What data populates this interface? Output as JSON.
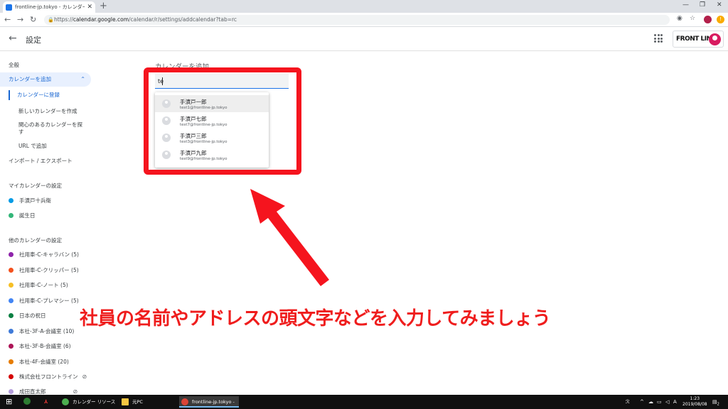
{
  "browser": {
    "tab_title": "frontline-jp.tokyo - カレンダー - 設定",
    "url_prefix": "https://",
    "url_host": "calendar.google.com",
    "url_path": "/calendar/r/settings/addcalendar?tab=rc"
  },
  "header": {
    "title": "設定",
    "logo_text": "FRONT LINE"
  },
  "sidebar": {
    "general": "全般",
    "add_calendar": "カレンダーを追加",
    "add_sub": [
      "カレンダーに登録",
      "新しいカレンダーを作成",
      "関心のあるカレンダーを探",
      "す",
      "URL で追加"
    ],
    "import_export": "インポート / エクスポート",
    "my_calendars_title": "マイカレンダーの設定",
    "my_calendars": [
      {
        "label": "手漬戸十兵衛",
        "color": "#039be5"
      },
      {
        "label": "誕生日",
        "color": "#33b679"
      }
    ],
    "other_calendars_title": "他のカレンダーの設定",
    "other_calendars": [
      {
        "label": "社用車-C-キャラバン (5)",
        "color": "#8e24aa"
      },
      {
        "label": "社用車-C-クリッパー (5)",
        "color": "#f4511e"
      },
      {
        "label": "社用車-C-ノート (5)",
        "color": "#f6bf26"
      },
      {
        "label": "社用車-C-プレマシー (5)",
        "color": "#4285f4"
      },
      {
        "label": "日本の祝日",
        "color": "#0b8043"
      },
      {
        "label": "本社-3F-A-会議室 (10)",
        "color": "#3f7ad8"
      },
      {
        "label": "本社-3F-B-会議室 (6)",
        "color": "#ad1457"
      },
      {
        "label": "本社-4F-会議室 (20)",
        "color": "#e67c00"
      },
      {
        "label": "株式会社フロントライン",
        "color": "#d50000"
      },
      {
        "label": "成田直太郎",
        "color": "#b39ddb"
      }
    ]
  },
  "main": {
    "section_title": "カレンダーを追加",
    "search_value": "te",
    "suggestions": [
      {
        "name": "手漬戸一郎",
        "email": "test1@frontline-jp.tokyo"
      },
      {
        "name": "手漬戸七郎",
        "email": "test7@frontline-jp.tokyo"
      },
      {
        "name": "手漬戸三郎",
        "email": "test3@frontline-jp.tokyo"
      },
      {
        "name": "手漬戸九郎",
        "email": "test9@frontline-jp.tokyo"
      }
    ]
  },
  "annotation": {
    "caption": "社員の名前やアドレスの頭文字などを入力してみましょう",
    "color": "#f5141e"
  },
  "taskbar": {
    "apps": [
      {
        "label": "カレンダー リソース -"
      },
      {
        "label": "元PC"
      },
      {
        "label": "frontline-jp.tokyo -"
      }
    ],
    "ime": "A",
    "time": "1:23",
    "date": "2019/08/08",
    "notif_count": "2"
  }
}
